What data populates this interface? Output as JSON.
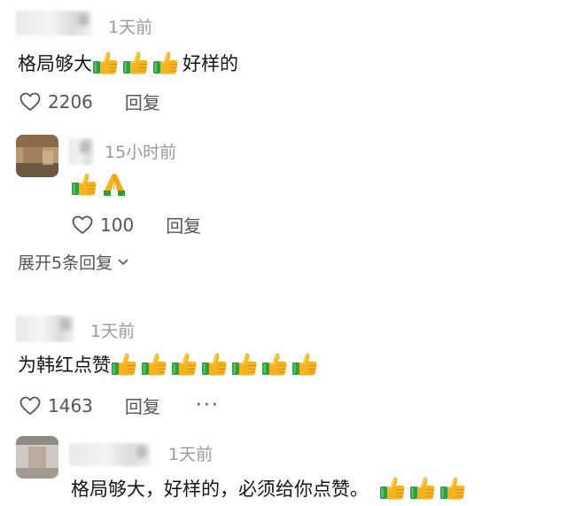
{
  "comments": [
    {
      "time": "1天前",
      "text": "格局够大",
      "text_after": "好样的",
      "likes": "2206",
      "reply_label": "回复"
    },
    {
      "time": "15小时前",
      "likes": "100",
      "reply_label": "回复"
    },
    {
      "time": "1天前",
      "text": "为韩红点赞",
      "likes": "1463",
      "reply_label": "回复",
      "more_label": "···"
    },
    {
      "time": "1天前",
      "text": "格局够大，好样的，必须给你点赞。"
    }
  ],
  "expand_replies": {
    "label": "展开5条回复"
  },
  "icons": {
    "thumbs_up": "thumbs-up-icon",
    "folded_hands": "folded-hands-icon",
    "heart": "heart-icon",
    "chevron": "chevron-down-icon"
  },
  "colors": {
    "thumb_yellow": "#F6B321",
    "cuff_green": "#2E9E3E",
    "time_gray": "#9A9A9A",
    "action_gray": "#555555"
  }
}
